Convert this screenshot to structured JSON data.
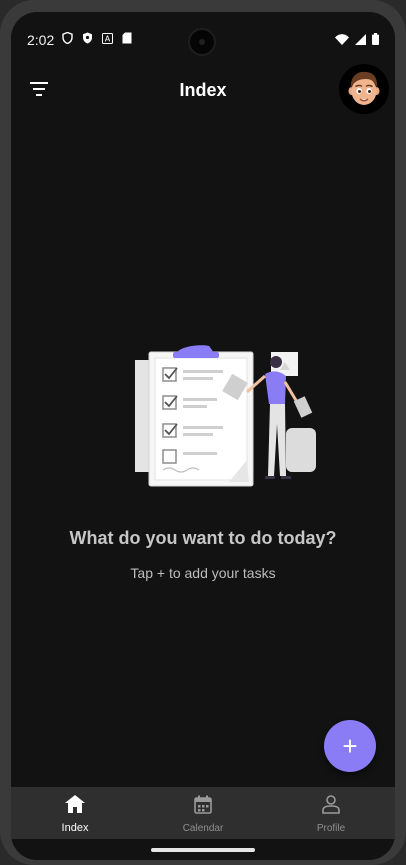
{
  "status_bar": {
    "time": "2:02",
    "left_icons": [
      "shield-icon",
      "vpn-icon",
      "a-icon",
      "sd-card-icon"
    ],
    "right_icons": [
      "wifi-icon",
      "signal-icon",
      "battery-icon"
    ]
  },
  "app_bar": {
    "title": "Index",
    "filter_icon": "filter-icon",
    "avatar": "profile-avatar"
  },
  "empty_state": {
    "headline": "What do you want to do today?",
    "subtext": "Tap + to add your tasks",
    "illustration": "checklist-person-illustration"
  },
  "fab": {
    "label": "+"
  },
  "bottom_nav": {
    "items": [
      {
        "label": "Index",
        "icon": "home-icon",
        "active": true
      },
      {
        "label": "Calendar",
        "icon": "calendar-icon",
        "active": false
      },
      {
        "label": "Profile",
        "icon": "person-icon",
        "active": false
      }
    ]
  },
  "colors": {
    "background": "#121212",
    "accent": "#8a7cf5",
    "nav_background": "#2f2f2f"
  }
}
